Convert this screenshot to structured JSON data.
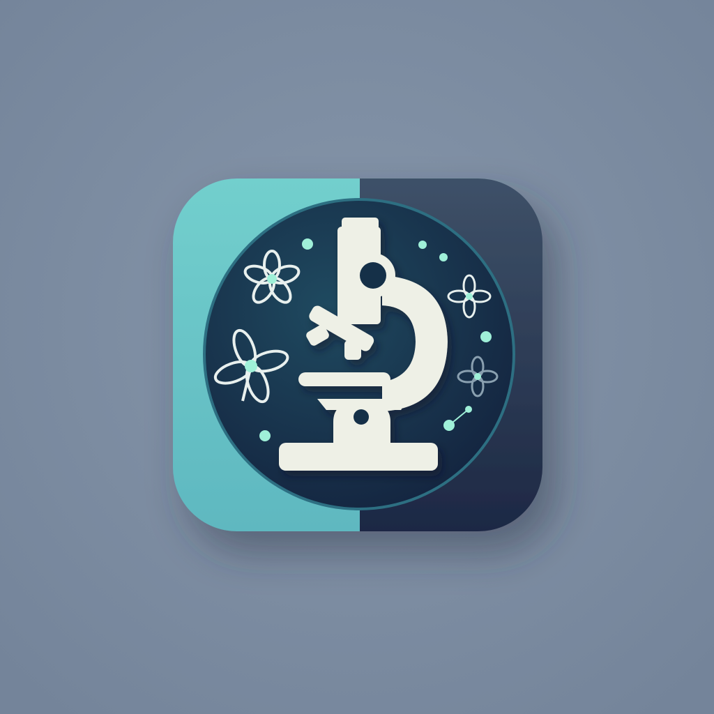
{
  "app_icon": {
    "icon": "microscope-icon",
    "decorations": [
      "flower-icon",
      "dot-icon"
    ],
    "colors": {
      "background": "#7d8ca0",
      "tile_left": "#6cc8c8",
      "tile_right": "#26344f",
      "circle": "#17334d",
      "microscope": "#eef0e6",
      "accent": "#9ff0d8"
    }
  }
}
